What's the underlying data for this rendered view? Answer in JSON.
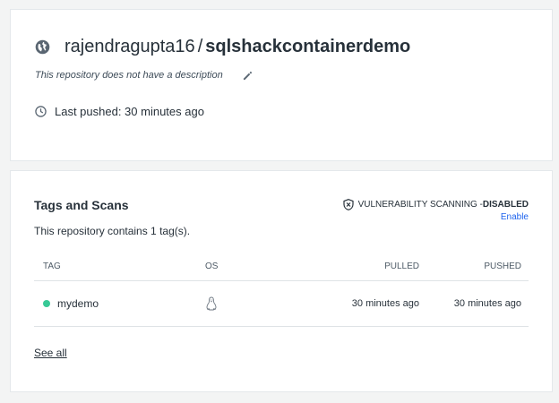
{
  "repo": {
    "namespace": "rajendragupta16",
    "separator": "/",
    "name": "sqlshackcontainerdemo",
    "description": "This repository does not have a description",
    "last_pushed": "Last pushed: 30 minutes ago",
    "icons": {
      "visibility": "globe-icon",
      "edit": "pencil-icon",
      "time": "clock-icon"
    }
  },
  "tags_section": {
    "title": "Tags and Scans",
    "count_text": "This repository contains 1 tag(s).",
    "vuln_label": "VULNERABILITY SCANNING - ",
    "vuln_status": "DISABLED",
    "enable_link": "Enable",
    "columns": {
      "tag": "TAG",
      "os": "OS",
      "pulled": "PULLED",
      "pushed": "PUSHED"
    },
    "rows": [
      {
        "tag": "mydemo",
        "os_icon": "linux-icon",
        "pulled": "30 minutes ago",
        "pushed": "30 minutes ago",
        "status_color": "#38c996"
      }
    ],
    "see_all": "See all"
  },
  "colors": {
    "accent_link": "#1d63ed",
    "tag_dot": "#38c996",
    "text": "#27313a",
    "background": "#f3f4f4"
  }
}
